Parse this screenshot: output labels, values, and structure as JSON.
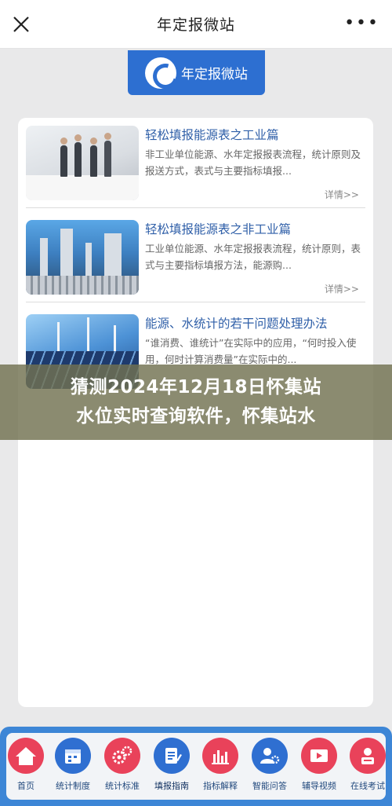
{
  "header": {
    "title": "年定报微站",
    "close_icon": "close-icon",
    "more_icon": "more-dots-icon",
    "more_glyph": "•••"
  },
  "banner": {
    "brand": "年定报微站"
  },
  "articles": [
    {
      "title": "轻松填报能源表之工业篇",
      "desc": "非工业单位能源、水年定报报表流程，统计原则及报送方式，表式与主要指标填报...",
      "more": "详情>>"
    },
    {
      "title": "轻松填报能源表之非工业篇",
      "desc": "工业单位能源、水年定报报表流程，统计原则，表式与主要指标填报方法，能源购...",
      "more": "详情>>"
    },
    {
      "title": "能源、水统计的若干问题处理办法",
      "desc": "“谁消费、谁统计”在实际中的应用，“何时投入使用，何时计算消费量”在实际中的...",
      "more": ""
    }
  ],
  "overlay": {
    "line1": "猜测2024年12月18日怀集站",
    "line2": "水位实时查询软件，怀集站水"
  },
  "tabs": [
    {
      "label": "首页",
      "icon": "home-icon",
      "color": "#e9425a"
    },
    {
      "label": "统计制度",
      "icon": "calendar-icon",
      "color": "#2f6fd1"
    },
    {
      "label": "统计标准",
      "icon": "gears-icon",
      "color": "#e9425a"
    },
    {
      "label": "填报指南",
      "icon": "document-pen-icon",
      "color": "#2f6fd1"
    },
    {
      "label": "指标解释",
      "icon": "bar-chart-icon",
      "color": "#e9425a"
    },
    {
      "label": "智能问答",
      "icon": "user-gear-icon",
      "color": "#2f6fd1"
    },
    {
      "label": "辅导视频",
      "icon": "video-icon",
      "color": "#e9425a"
    },
    {
      "label": "在线考试",
      "icon": "exam-icon",
      "color": "#e9425a"
    }
  ],
  "active_tab": "填报指南",
  "colors": {
    "accent": "#2d6fd1",
    "tabbar": "#3d86d6",
    "title_blue": "#2f5fa8",
    "overlay": "#717150"
  }
}
